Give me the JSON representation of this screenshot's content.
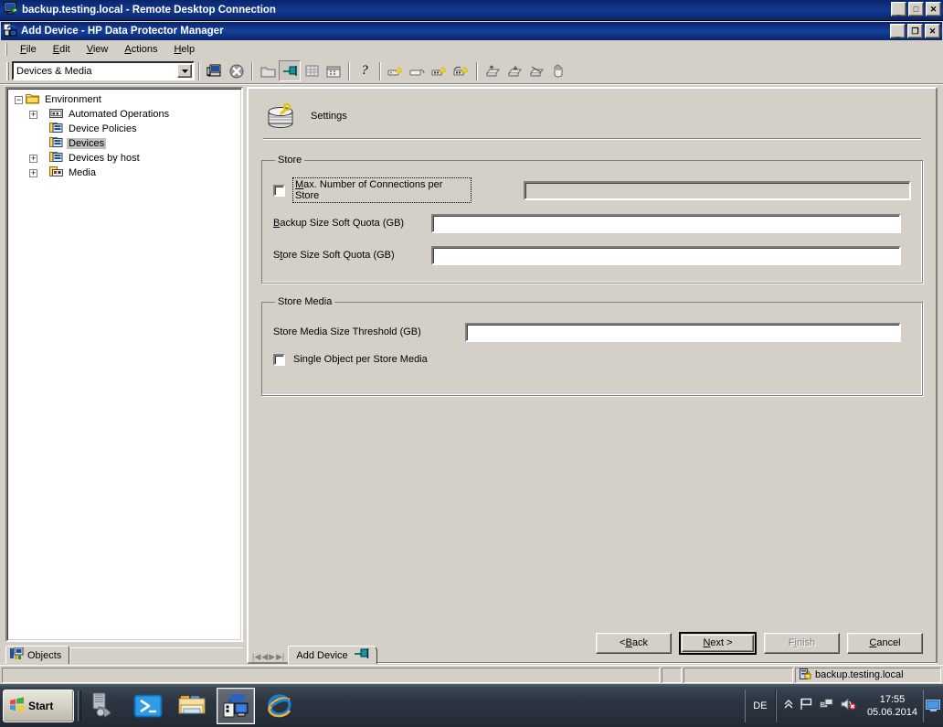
{
  "rdp": {
    "title": "backup.testing.local - Remote Desktop Connection",
    "minimize": "_",
    "maximize": "□",
    "close": "✕"
  },
  "app": {
    "title": "Add Device - HP Data Protector Manager",
    "minimize": "_",
    "restore": "❐",
    "close": "✕"
  },
  "menubar": {
    "items": [
      {
        "pre": "",
        "key": "F",
        "post": "ile"
      },
      {
        "pre": "",
        "key": "E",
        "post": "dit"
      },
      {
        "pre": "",
        "key": "V",
        "post": "iew"
      },
      {
        "pre": "",
        "key": "A",
        "post": "ctions"
      },
      {
        "pre": "",
        "key": "H",
        "post": "elp"
      }
    ]
  },
  "toolbar": {
    "context_combo_value": "Devices & Media",
    "dropdown_arrow": "▼",
    "buttons": [
      "computer-icon",
      "stop-icon",
      "folder-icon",
      "pin-flag-icon",
      "grid-icon",
      "calendar-icon",
      "help-question-icon",
      "new-device-icon",
      "open-device-icon",
      "new-media-icon",
      "media-pool-icon",
      "import-icon",
      "export-icon",
      "scan-icon",
      "hand-icon"
    ]
  },
  "tree": {
    "root": "Environment",
    "items": [
      {
        "label": "Environment",
        "indent": 0,
        "expander": "-",
        "icon": "folder-icon",
        "selected": false
      },
      {
        "label": "Automated Operations",
        "indent": 1,
        "expander": "+",
        "icon": "automated-operations-icon",
        "selected": false
      },
      {
        "label": "Device Policies",
        "indent": 1,
        "expander": "",
        "icon": "device-icon",
        "selected": false
      },
      {
        "label": "Devices",
        "indent": 1,
        "expander": "",
        "icon": "device-icon",
        "selected": true
      },
      {
        "label": "Devices by host",
        "indent": 1,
        "expander": "+",
        "icon": "device-icon",
        "selected": false
      },
      {
        "label": "Media",
        "indent": 1,
        "expander": "+",
        "icon": "media-icon",
        "selected": false
      }
    ],
    "objects_tab": "Objects"
  },
  "wizard": {
    "header_title": "Settings",
    "header_icon": "disk-stack-key-icon",
    "store_group": {
      "legend": "Store",
      "max_connections": {
        "label_pre": "M",
        "label_key": "M",
        "label": "ax. Number of Connections per Store",
        "full_label": "Max. Number of Connections per Store",
        "checked": false,
        "value": "",
        "input_disabled": true,
        "focused": true
      },
      "backup_quota": {
        "label_key": "B",
        "label_rest": "ackup Size Soft Quota (GB)",
        "full_label": "Backup Size Soft Quota (GB)",
        "value": ""
      },
      "store_quota": {
        "label_key": "S",
        "label_pre": "S",
        "label_mid": "t",
        "label_rest": "ore Size Soft Quota (GB)",
        "full_label": "Store Size Soft Quota (GB)",
        "value": ""
      }
    },
    "store_media_group": {
      "legend": "Store Media",
      "threshold": {
        "full_label": "Store Media Size Threshold (GB)",
        "value": ""
      },
      "single_object": {
        "full_label": "Single Object per Store Media",
        "checked": false
      }
    },
    "buttons": {
      "back": "< Back",
      "back_key": "B",
      "next": "Next >",
      "next_key": "N",
      "finish": "Finish",
      "finish_key": "i",
      "cancel": "Cancel",
      "cancel_key": "C"
    }
  },
  "tabstrip": {
    "nav": [
      "|◀",
      "◀",
      "▶",
      "▶|"
    ],
    "tab_label": "Add Device",
    "tab_icon": "pin-flag-icon"
  },
  "statusbar": {
    "host": "backup.testing.local",
    "host_icon": "secure-server-icon"
  },
  "taskbar": {
    "start_label": "Start",
    "quicklaunch": [
      {
        "name": "server-manager-icon",
        "active": false
      },
      {
        "name": "powershell-icon",
        "active": false
      },
      {
        "name": "file-explorer-icon",
        "active": false
      },
      {
        "name": "data-protector-icon",
        "active": true
      },
      {
        "name": "internet-explorer-icon",
        "active": false
      }
    ],
    "tray": {
      "language": "DE",
      "icons": [
        "chevron-up-icon",
        "flag-icon",
        "network-icon",
        "speaker-muted-icon"
      ],
      "time": "17:55",
      "date": "05.06.2014",
      "show_desktop_icon": "show-desktop-icon"
    }
  }
}
